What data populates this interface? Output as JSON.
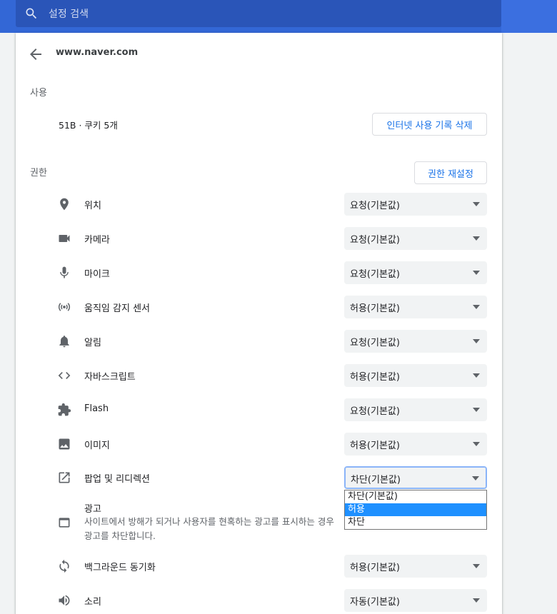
{
  "search": {
    "placeholder": "설정 검색"
  },
  "header": {
    "site": "www.naver.com"
  },
  "usage": {
    "section_label": "사용",
    "text": "51B · 쿠키 5개",
    "clear_button": "인터넷 사용 기록 삭제"
  },
  "permissions": {
    "section_label": "권한",
    "reset_button": "권한 재설정",
    "items": [
      {
        "label": "위치",
        "icon": "location-pin-icon",
        "value": "요청(기본값)"
      },
      {
        "label": "카메라",
        "icon": "camera-icon",
        "value": "요청(기본값)"
      },
      {
        "label": "마이크",
        "icon": "microphone-icon",
        "value": "요청(기본값)"
      },
      {
        "label": "움직임 감지 센서",
        "icon": "sensors-icon",
        "value": "허용(기본값)"
      },
      {
        "label": "알림",
        "icon": "bell-icon",
        "value": "요청(기본값)"
      },
      {
        "label": "자바스크립트",
        "icon": "code-icon",
        "value": "허용(기본값)"
      },
      {
        "label": "Flash",
        "icon": "puzzle-icon",
        "value": "요청(기본값)"
      },
      {
        "label": "이미지",
        "icon": "image-icon",
        "value": "허용(기본값)"
      },
      {
        "label": "팝업 및 리디렉션",
        "icon": "open-in-new-icon",
        "value": "차단(기본값)"
      }
    ],
    "popup_dropdown": {
      "options": [
        "차단(기본값)",
        "허용",
        "차단"
      ],
      "highlighted": "허용"
    },
    "ads": {
      "title": "광고",
      "description": "사이트에서 방해가 되거나 사용자를 현혹하는 광고를 표시하는 경우 광고를 차단합니다.",
      "icon": "ads-window-icon"
    },
    "more": [
      {
        "label": "백그라운드 동기화",
        "icon": "sync-icon",
        "value": "허용(기본값)"
      },
      {
        "label": "소리",
        "icon": "speaker-icon",
        "value": "자동(기본값)"
      }
    ]
  },
  "colors": {
    "accent": "#1a73e8",
    "header": "#3367d6",
    "highlight": "#1e90ff"
  }
}
